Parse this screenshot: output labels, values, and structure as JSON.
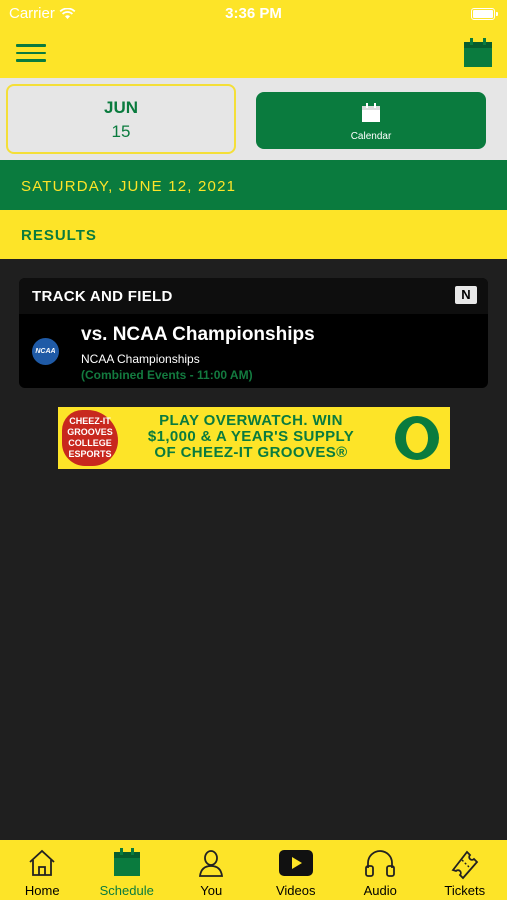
{
  "statusbar": {
    "carrier": "Carrier",
    "time": "3:36 PM"
  },
  "date_selector": {
    "month": "JUN",
    "day": "15",
    "calendar_label": "Calendar"
  },
  "day_header": "SATURDAY, JUNE 12, 2021",
  "section_header": "RESULTS",
  "event_card": {
    "sport": "TRACK AND FIELD",
    "network_badge": "N",
    "opponent_logo_text": "NCAA",
    "title": "vs. NCAA Championships",
    "subtitle": "NCAA Championships",
    "detail": "(Combined Events - 11:00 AM)"
  },
  "ad": {
    "badge_lines": [
      "CHEEZ-IT",
      "GROOVES",
      "COLLEGE",
      "ESPORTS"
    ],
    "copy_lines": [
      "PLAY OVERWATCH.  WIN",
      "$1,000 & A YEAR'S SUPPLY",
      "OF CHEEZ-IT GROOVES®"
    ]
  },
  "tabs": [
    {
      "label": "Home",
      "icon": "home-icon"
    },
    {
      "label": "Schedule",
      "icon": "calendar-icon",
      "active": true
    },
    {
      "label": "You",
      "icon": "person-icon"
    },
    {
      "label": "Videos",
      "icon": "play-icon"
    },
    {
      "label": "Audio",
      "icon": "headphones-icon"
    },
    {
      "label": "Tickets",
      "icon": "ticket-icon"
    }
  ],
  "colors": {
    "yellow": "#fde428",
    "green": "#0a7b3e",
    "dark": "#1f1f1f"
  }
}
